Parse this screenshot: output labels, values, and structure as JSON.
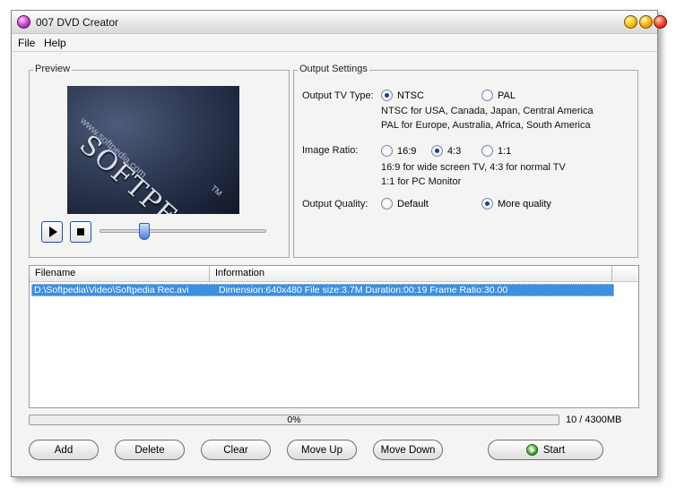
{
  "window": {
    "title": "007 DVD Creator"
  },
  "menu": {
    "file": "File",
    "help": "Help"
  },
  "preview": {
    "group_label": "Preview",
    "image_text": "SOFTPEDIA",
    "image_url_text": "www.softpedia.com",
    "image_tm": "TM",
    "slider_position": 0.25
  },
  "settings": {
    "group_label": "Output Settings",
    "tv_type": {
      "label": "Output TV Type:",
      "options": [
        "NTSC",
        "PAL"
      ],
      "selected": "NTSC",
      "ntsc_desc": "NTSC for USA, Canada, Japan, Central  America",
      "pal_desc": "PAL for Europe, Australia, Africa, South America"
    },
    "ratio": {
      "label": "Image Ratio:",
      "options": [
        "16:9",
        "4:3",
        "1:1"
      ],
      "selected": "4:3",
      "desc1": "16:9 for wide screen TV,  4:3 for normal TV",
      "desc2": "1:1 for PC Monitor"
    },
    "quality": {
      "label": "Output Quality:",
      "options": [
        "Default",
        "More quality"
      ],
      "selected": "More quality"
    }
  },
  "list": {
    "columns": [
      "Filename",
      "Information"
    ],
    "rows": [
      {
        "filename": "D:\\Softpedia\\Video\\Softpedia Rec.avi",
        "information": "Dimension:640x480 File size:3.7M Duration:00:19 Frame Ratio:30.00"
      }
    ]
  },
  "progress": {
    "percent_text": "0%",
    "value": 0
  },
  "size_text": "10 / 4300MB",
  "buttons": {
    "add": "Add",
    "delete": "Delete",
    "clear": "Clear",
    "move_up": "Move Up",
    "move_down": "Move Down",
    "start": "Start"
  },
  "colors": {
    "selection": "#3d8fdf",
    "radio_dot": "#1e3e8a"
  }
}
